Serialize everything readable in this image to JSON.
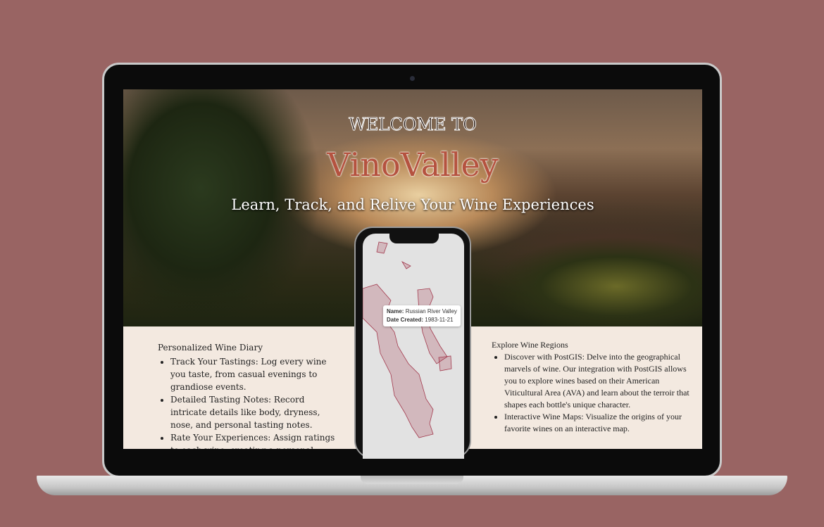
{
  "hero": {
    "welcome": "WELCOME TO",
    "brand": "VinoValley",
    "tagline": "Learn, Track, and Relive Your Wine Experiences"
  },
  "left": {
    "heading": "Personalized Wine Diary",
    "items": [
      "Track Your Tastings: Log every wine you taste, from casual evenings to grandiose events.",
      "Detailed Tasting Notes: Record intricate details like body, dryness, nose, and personal tasting notes.",
      "Rate Your Experiences: Assign ratings to each wine, creating a personal archive of"
    ]
  },
  "right": {
    "heading": "Explore Wine Regions",
    "items": [
      "Discover with PostGIS: Delve into the geographical marvels of wine. Our integration with PostGIS allows you to explore wines based on their American Viticultural Area (AVA) and learn about the terroir that shapes each bottle's unique character.",
      "Interactive Wine Maps: Visualize the origins of your favorite wines on an interactive map."
    ]
  },
  "map": {
    "tooltip": {
      "name_label": "Name:",
      "name": "Russian River Valley",
      "date_label": "Date Created:",
      "date": "1983-11-21"
    },
    "region_color": "#a33a4e"
  },
  "colors": {
    "background": "#996463",
    "brand": "#b5523f",
    "content_bg": "#f3e9e0"
  }
}
